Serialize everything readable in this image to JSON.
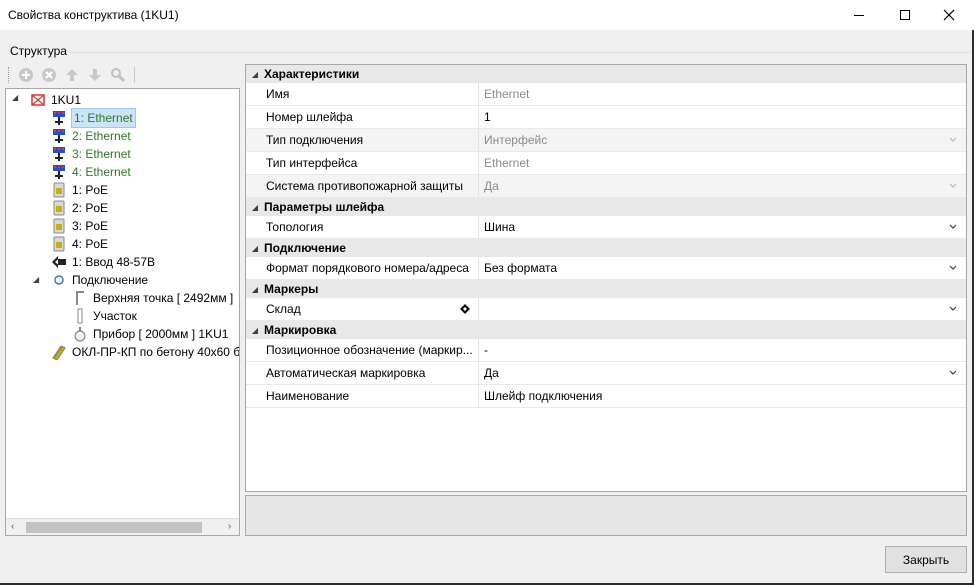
{
  "window": {
    "title": "Свойства конструктива (1KU1)"
  },
  "structure": {
    "group_label": "Структура",
    "toolbar": {
      "icons": [
        "add-icon",
        "remove-icon",
        "move-up-icon",
        "move-down-icon",
        "settings-icon"
      ]
    },
    "tree": {
      "root": "1KU1",
      "items": [
        {
          "label": "1: Ethernet",
          "icon": "ethernet-icon",
          "color": "#2a7a2a",
          "selected": true
        },
        {
          "label": "2: Ethernet",
          "icon": "ethernet-icon",
          "color": "#2a7a2a"
        },
        {
          "label": "3: Ethernet",
          "icon": "ethernet-icon",
          "color": "#2a7a2a"
        },
        {
          "label": "4: Ethernet",
          "icon": "ethernet-icon",
          "color": "#2a7a2a"
        },
        {
          "label": "1: PoE",
          "icon": "poe-icon"
        },
        {
          "label": "2: PoE",
          "icon": "poe-icon"
        },
        {
          "label": "3: PoE",
          "icon": "poe-icon"
        },
        {
          "label": "4: PoE",
          "icon": "poe-icon"
        },
        {
          "label": "1: Ввод 48-57В",
          "icon": "input-arrow-icon"
        }
      ],
      "connection": {
        "label": "Подключение",
        "children": [
          {
            "label": "Верхняя точка [ 2492мм ]",
            "icon": "top-point-icon"
          },
          {
            "label": "Участок",
            "icon": "segment-icon"
          },
          {
            "label": "Прибор [ 2000мм ] 1KU1",
            "icon": "device-icon"
          }
        ]
      },
      "cable": {
        "label": "ОКЛ-ПР-КП по бетону 40x60 б",
        "icon": "cable-icon"
      }
    }
  },
  "properties": {
    "categories": [
      {
        "name": "Характеристики",
        "rows": [
          {
            "name": "Имя",
            "value": "Ethernet",
            "disabled": true
          },
          {
            "name": "Номер шлейфа",
            "value": "1"
          },
          {
            "name": "Тип подключения",
            "value": "Интерфейс",
            "disabled": true,
            "dropdown": true
          },
          {
            "name": "Тип интерфейса",
            "value": "Ethernet",
            "disabled": true
          },
          {
            "name": "Система противопожарной защиты",
            "value": "Да",
            "disabled": true,
            "dropdown": true
          }
        ]
      },
      {
        "name": "Параметры шлейфа",
        "rows": [
          {
            "name": "Топология",
            "value": "Шина",
            "dropdown": true
          }
        ]
      },
      {
        "name": "Подключение",
        "rows": [
          {
            "name": "Формат порядкового номера/адреса",
            "value": "Без формата",
            "dropdown": true
          }
        ]
      },
      {
        "name": "Маркеры",
        "rows": [
          {
            "name": "Склад",
            "value": "",
            "dropdown": true,
            "marker": true
          }
        ]
      },
      {
        "name": "Маркировка",
        "rows": [
          {
            "name": "Позиционное обозначение (маркир...",
            "value": "-"
          },
          {
            "name": "Автоматическая маркировка",
            "value": "Да",
            "dropdown": true
          },
          {
            "name": "Наименование",
            "value": "Шлейф подключения"
          }
        ]
      }
    ]
  },
  "buttons": {
    "close": "Закрыть"
  }
}
